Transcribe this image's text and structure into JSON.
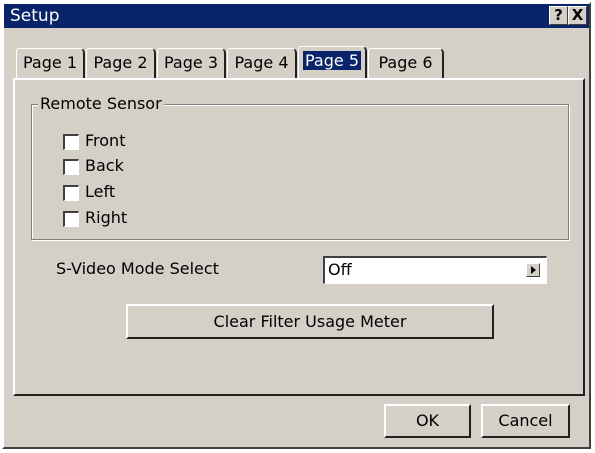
{
  "window": {
    "title": "Setup",
    "help_label": "?",
    "close_label": "X"
  },
  "tabs": [
    {
      "label": "Page 1",
      "active": false
    },
    {
      "label": "Page 2",
      "active": false
    },
    {
      "label": "Page 3",
      "active": false
    },
    {
      "label": "Page 4",
      "active": false
    },
    {
      "label": "Page 5",
      "active": true
    },
    {
      "label": "Page 6",
      "active": false
    }
  ],
  "remote_sensor": {
    "group_label": "Remote Sensor",
    "options": [
      {
        "label": "Front",
        "checked": false
      },
      {
        "label": "Back",
        "checked": false
      },
      {
        "label": "Left",
        "checked": false
      },
      {
        "label": "Right",
        "checked": false
      }
    ]
  },
  "svideo": {
    "label": "S-Video Mode Select",
    "value": "Off"
  },
  "clear_filter_label": "Clear Filter Usage Meter",
  "footer": {
    "ok_label": "OK",
    "cancel_label": "Cancel"
  },
  "colors": {
    "face": "#d4d0c8",
    "titlebar": "#0a246a",
    "highlight": "#0a246a"
  }
}
